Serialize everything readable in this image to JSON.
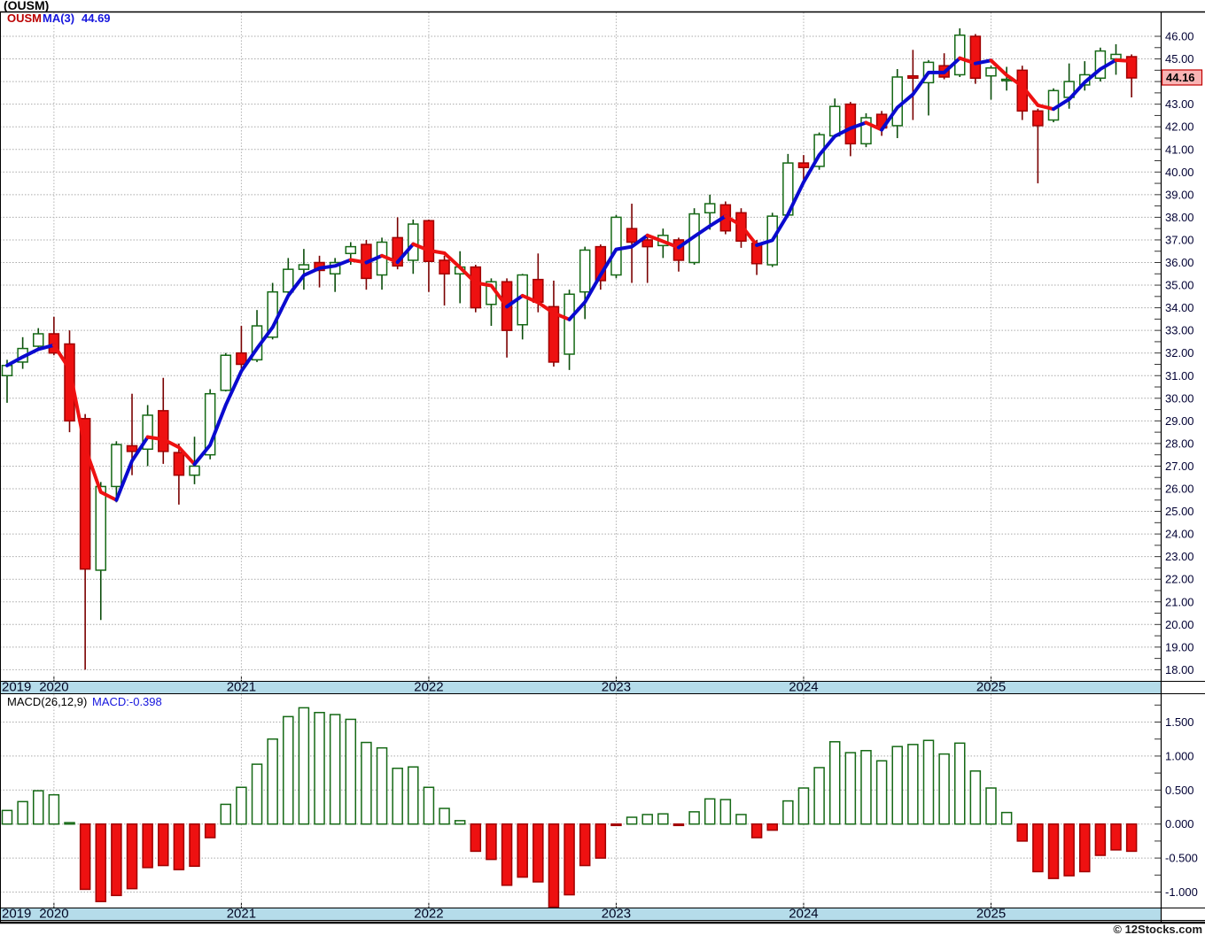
{
  "header": {
    "title": "(OUSM)"
  },
  "legend": {
    "symbol": "OUSM",
    "ma_label": "MA(3)",
    "ma_value": "44.69"
  },
  "last_price": {
    "label": "44.16",
    "value": 44.16
  },
  "macd_panel": {
    "label": "MACD(26,12,9)",
    "value_label": "MACD:-0.398",
    "last_value": -0.398
  },
  "footer": {
    "copyright": "© 12Stocks.com"
  },
  "colors": {
    "band": "#b5dcea",
    "grid": "#aaaaaa",
    "axis_text": "#000033",
    "candle_down_fill": "#ee1111",
    "candle_down_stroke": "#a00000",
    "wick_down": "#7a0000",
    "candle_up_fill": "#ffffff",
    "candle_up_stroke": "#156915",
    "wick_up": "#0b4d0b",
    "ma_up": "#0a0acf",
    "ma_down": "#ee1111",
    "last_price_bg": "#f9b4b4",
    "last_price_border": "#c00000"
  },
  "price_axis": {
    "min": 18,
    "max": 46,
    "label_step": 1,
    "minor_step": 0.5,
    "tick_labels": [
      "46.00",
      "45.00",
      "44.00",
      "43.00",
      "42.00",
      "41.00",
      "40.00",
      "39.00",
      "38.00",
      "37.00",
      "36.00",
      "35.00",
      "34.00",
      "33.00",
      "32.00",
      "31.00",
      "30.00",
      "29.00",
      "28.00",
      "27.00",
      "26.00",
      "25.00",
      "24.00",
      "23.00",
      "22.00",
      "21.00",
      "20.00",
      "19.00",
      "18.00"
    ]
  },
  "macd_axis": {
    "tick_values": [
      1.5,
      1.0,
      0.5,
      0.0,
      -0.5,
      -1.0
    ],
    "tick_labels": [
      "1.500",
      "1.000",
      "0.500",
      "0.000",
      "-0.500",
      "-1.000"
    ]
  },
  "x_axis": {
    "years": [
      "2019",
      "2020",
      "2021",
      "2022",
      "2023",
      "2024",
      "2025"
    ]
  },
  "chart_data": {
    "type": "candlestick",
    "title": "(OUSM)",
    "subtitle_indicator": "MACD(26,12,9)",
    "ylim": [
      17.6,
      46.5
    ],
    "macd_ylim": [
      -1.35,
      1.9
    ],
    "grid": true,
    "months": [
      "2019-10",
      "2019-11",
      "2019-12",
      "2020-01",
      "2020-02",
      "2020-03",
      "2020-04",
      "2020-05",
      "2020-06",
      "2020-07",
      "2020-08",
      "2020-09",
      "2020-10",
      "2020-11",
      "2020-12",
      "2021-01",
      "2021-02",
      "2021-03",
      "2021-04",
      "2021-05",
      "2021-06",
      "2021-07",
      "2021-08",
      "2021-09",
      "2021-10",
      "2021-11",
      "2021-12",
      "2022-01",
      "2022-02",
      "2022-03",
      "2022-04",
      "2022-05",
      "2022-06",
      "2022-07",
      "2022-08",
      "2022-09",
      "2022-10",
      "2022-11",
      "2022-12",
      "2023-01",
      "2023-02",
      "2023-03",
      "2023-04",
      "2023-05",
      "2023-06",
      "2023-07",
      "2023-08",
      "2023-09",
      "2023-10",
      "2023-11",
      "2023-12",
      "2024-01",
      "2024-02",
      "2024-03",
      "2024-04",
      "2024-05",
      "2024-06",
      "2024-07",
      "2024-08",
      "2024-09",
      "2024-10",
      "2024-11",
      "2024-12",
      "2025-01",
      "2025-02",
      "2025-03",
      "2025-04",
      "2025-05",
      "2025-06",
      "2025-07",
      "2025-08",
      "2025-09",
      "2025-10"
    ],
    "ohlc": [
      [
        31.0,
        31.7,
        29.8,
        31.45
      ],
      [
        31.6,
        32.7,
        31.3,
        32.2
      ],
      [
        32.3,
        33.1,
        32.1,
        32.85
      ],
      [
        32.85,
        33.6,
        31.9,
        32.0
      ],
      [
        32.4,
        33.0,
        28.5,
        29.0
      ],
      [
        29.1,
        29.3,
        18.0,
        22.45
      ],
      [
        22.4,
        26.3,
        20.2,
        26.1
      ],
      [
        26.1,
        28.1,
        25.4,
        27.95
      ],
      [
        27.9,
        30.2,
        26.6,
        27.65
      ],
      [
        27.75,
        29.7,
        27.0,
        29.25
      ],
      [
        29.45,
        30.9,
        27.1,
        27.65
      ],
      [
        27.6,
        28.0,
        25.3,
        26.6
      ],
      [
        26.6,
        28.3,
        26.2,
        27.0
      ],
      [
        27.5,
        30.4,
        27.3,
        30.2
      ],
      [
        30.35,
        32.0,
        30.3,
        31.9
      ],
      [
        32.0,
        33.2,
        31.3,
        31.5
      ],
      [
        31.7,
        33.9,
        31.6,
        33.2
      ],
      [
        32.7,
        35.1,
        32.6,
        34.7
      ],
      [
        34.7,
        36.2,
        34.6,
        35.7
      ],
      [
        35.7,
        36.6,
        34.8,
        35.9
      ],
      [
        36.0,
        36.3,
        34.9,
        35.65
      ],
      [
        35.5,
        36.2,
        34.7,
        36.0
      ],
      [
        36.4,
        36.9,
        35.9,
        36.7
      ],
      [
        36.8,
        37.0,
        34.8,
        35.3
      ],
      [
        35.45,
        37.1,
        34.8,
        36.9
      ],
      [
        37.1,
        38.0,
        35.7,
        35.85
      ],
      [
        36.1,
        37.9,
        35.5,
        37.7
      ],
      [
        37.85,
        37.9,
        34.7,
        36.05
      ],
      [
        36.1,
        36.3,
        34.1,
        35.5
      ],
      [
        35.5,
        36.5,
        34.2,
        35.8
      ],
      [
        35.8,
        35.9,
        33.8,
        34.0
      ],
      [
        34.15,
        35.3,
        33.2,
        35.15
      ],
      [
        35.15,
        35.3,
        31.8,
        33.0
      ],
      [
        33.25,
        35.5,
        32.6,
        35.45
      ],
      [
        35.25,
        36.4,
        33.8,
        34.25
      ],
      [
        34.05,
        35.2,
        31.4,
        31.6
      ],
      [
        31.95,
        34.8,
        31.25,
        34.6
      ],
      [
        34.7,
        36.7,
        33.5,
        36.55
      ],
      [
        36.7,
        36.8,
        34.8,
        35.2
      ],
      [
        35.45,
        38.1,
        35.3,
        38.0
      ],
      [
        37.5,
        38.6,
        35.1,
        36.9
      ],
      [
        37.0,
        37.2,
        35.1,
        36.7
      ],
      [
        36.75,
        37.5,
        36.2,
        37.2
      ],
      [
        37.0,
        37.1,
        35.6,
        36.1
      ],
      [
        36.0,
        38.4,
        35.9,
        38.15
      ],
      [
        38.2,
        39.0,
        37.45,
        38.6
      ],
      [
        38.55,
        38.7,
        37.25,
        37.4
      ],
      [
        38.2,
        38.4,
        36.65,
        36.95
      ],
      [
        36.85,
        37.0,
        35.45,
        35.95
      ],
      [
        35.9,
        38.2,
        35.8,
        38.05
      ],
      [
        38.1,
        40.8,
        38.0,
        40.4
      ],
      [
        40.4,
        40.75,
        39.65,
        40.2
      ],
      [
        40.25,
        41.75,
        40.1,
        41.65
      ],
      [
        41.6,
        43.25,
        41.5,
        42.9
      ],
      [
        43.0,
        43.1,
        40.7,
        41.25
      ],
      [
        41.25,
        42.6,
        41.1,
        42.4
      ],
      [
        42.55,
        42.7,
        41.6,
        41.95
      ],
      [
        42.05,
        44.55,
        41.5,
        44.2
      ],
      [
        44.25,
        45.4,
        42.3,
        44.15
      ],
      [
        43.95,
        44.95,
        42.5,
        44.85
      ],
      [
        44.7,
        45.25,
        44.1,
        44.2
      ],
      [
        44.3,
        46.35,
        44.2,
        46.05
      ],
      [
        46.0,
        46.1,
        43.9,
        44.15
      ],
      [
        44.25,
        44.7,
        43.2,
        44.6
      ],
      [
        44.05,
        44.65,
        43.6,
        44.1
      ],
      [
        44.5,
        44.7,
        42.3,
        42.7
      ],
      [
        42.7,
        42.8,
        39.5,
        42.05
      ],
      [
        42.3,
        43.7,
        42.2,
        43.6
      ],
      [
        43.3,
        44.8,
        42.8,
        44.0
      ],
      [
        43.85,
        44.9,
        43.6,
        44.3
      ],
      [
        44.15,
        45.5,
        44.0,
        45.35
      ],
      [
        45.0,
        45.65,
        44.3,
        45.2
      ],
      [
        45.1,
        45.2,
        43.3,
        44.16
      ]
    ],
    "ma3_last": 44.69,
    "last_close": 44.16,
    "macd_histogram": [
      0.2,
      0.33,
      0.49,
      0.43,
      0.02,
      -0.96,
      -1.14,
      -1.05,
      -0.95,
      -0.64,
      -0.61,
      -0.67,
      -0.62,
      -0.2,
      0.29,
      0.54,
      0.88,
      1.25,
      1.58,
      1.71,
      1.64,
      1.61,
      1.54,
      1.2,
      1.12,
      0.82,
      0.84,
      0.54,
      0.23,
      0.05,
      -0.4,
      -0.52,
      -0.9,
      -0.78,
      -0.85,
      -1.22,
      -1.04,
      -0.61,
      -0.5,
      -0.02,
      0.1,
      0.14,
      0.15,
      -0.02,
      0.18,
      0.37,
      0.36,
      0.14,
      -0.2,
      -0.09,
      0.34,
      0.53,
      0.83,
      1.21,
      1.05,
      1.08,
      0.93,
      1.14,
      1.17,
      1.23,
      1.03,
      1.19,
      0.78,
      0.53,
      0.17,
      -0.25,
      -0.7,
      -0.8,
      -0.76,
      -0.7,
      -0.46,
      -0.38,
      -0.4
    ]
  }
}
